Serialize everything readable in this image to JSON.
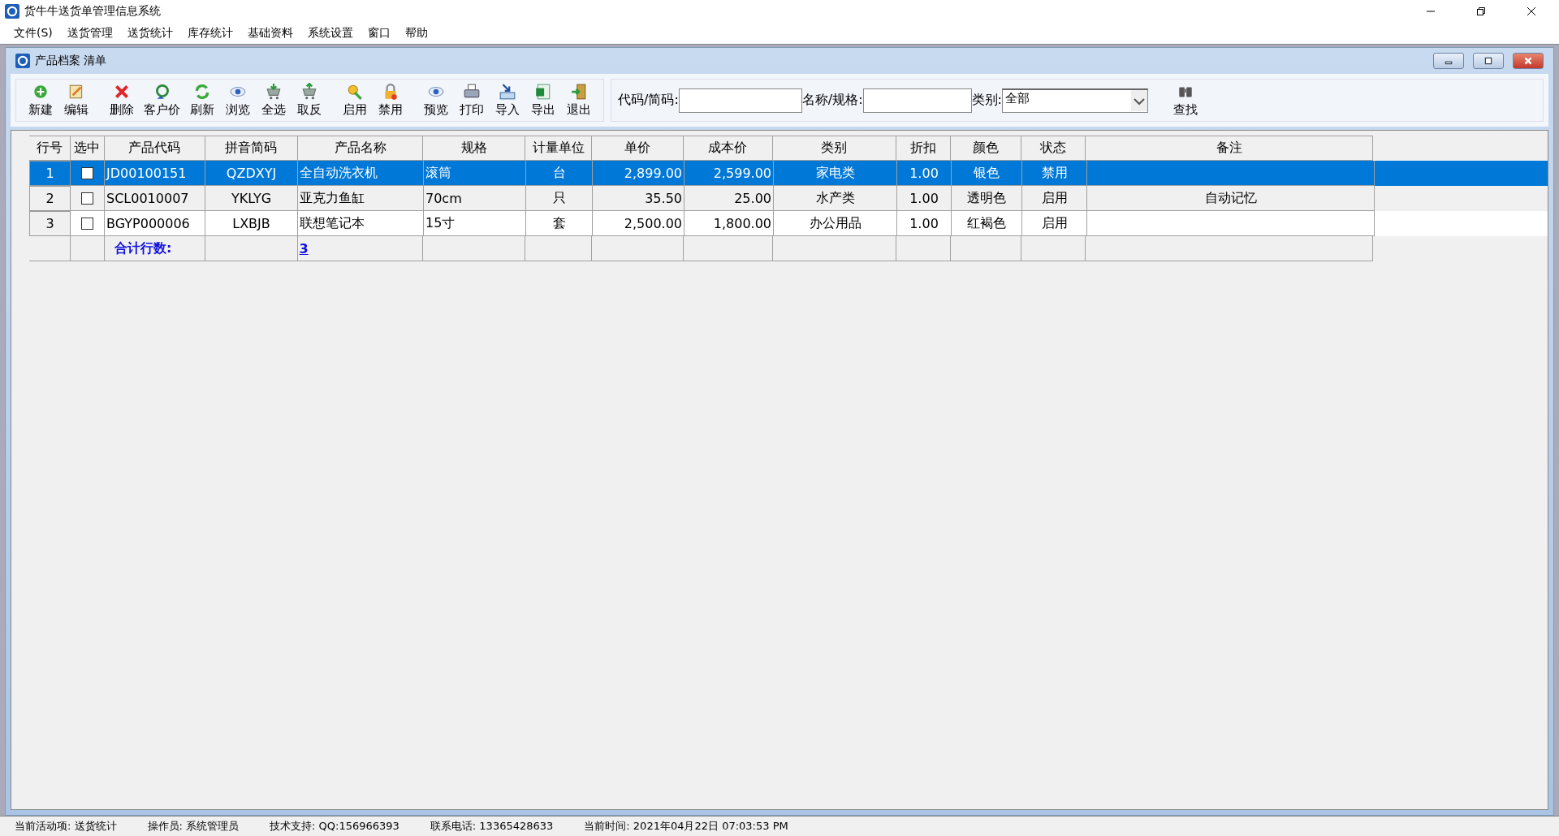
{
  "window": {
    "title": "货牛牛送货单管理信息系统"
  },
  "menu": [
    "文件(S)",
    "送货管理",
    "送货统计",
    "库存统计",
    "基础资料",
    "系统设置",
    "窗口",
    "帮助"
  ],
  "child_window": {
    "title": "产品档案 清单"
  },
  "toolbar": [
    {
      "kind": "add",
      "label": "新建"
    },
    {
      "kind": "edit",
      "label": "编辑"
    },
    {
      "kind": "delete",
      "label": "删除"
    },
    {
      "kind": "price",
      "label": "客户价"
    },
    {
      "kind": "refresh",
      "label": "刷新"
    },
    {
      "kind": "view",
      "label": "浏览"
    },
    {
      "kind": "select_all",
      "label": "全选"
    },
    {
      "kind": "invert",
      "label": "取反"
    },
    {
      "kind": "enable",
      "label": "启用"
    },
    {
      "kind": "disable",
      "label": "禁用"
    },
    {
      "kind": "view",
      "label": "预览"
    },
    {
      "kind": "print",
      "label": "打印"
    },
    {
      "kind": "import",
      "label": "导入"
    },
    {
      "kind": "export",
      "label": "导出"
    },
    {
      "kind": "exit",
      "label": "退出"
    }
  ],
  "filters": {
    "code_label": "代码/简码:",
    "name_label": "名称/规格:",
    "category_label": "类别:",
    "category_value": "全部",
    "search_label": "查找"
  },
  "table": {
    "columns": [
      "行号",
      "选中",
      "产品代码",
      "拼音简码",
      "产品名称",
      "规格",
      "计量单位",
      "单价",
      "成本价",
      "类别",
      "折扣",
      "颜色",
      "状态",
      "备注"
    ],
    "rows": [
      {
        "selected": true,
        "checked": false,
        "cells": [
          "1",
          "",
          "JD00100151",
          "QZDXYJ",
          "全自动洗衣机",
          "滚筒",
          "台",
          "2,899.00",
          "2,599.00",
          "家电类",
          "1.00",
          "银色",
          "禁用",
          ""
        ]
      },
      {
        "selected": false,
        "checked": false,
        "cells": [
          "2",
          "",
          "SCL0010007",
          "YKLYG",
          "亚克力鱼缸",
          "70cm",
          "只",
          "35.50",
          "25.00",
          "水产类",
          "1.00",
          "透明色",
          "启用",
          "自动记忆"
        ]
      },
      {
        "selected": false,
        "checked": false,
        "cells": [
          "3",
          "",
          "BGYP000006",
          "LXBJB",
          "联想笔记本",
          "15寸",
          "套",
          "2,500.00",
          "1,800.00",
          "办公用品",
          "1.00",
          "红褐色",
          "启用",
          ""
        ]
      }
    ],
    "summary": {
      "label": "合计行数:",
      "count": "3"
    }
  },
  "status_bar": [
    "当前活动项: 送货统计",
    "操作员: 系统管理员",
    "技术支持: QQ:156966393",
    "联系电话: 13365428633",
    "当前时间: 2021年04月22日 07:03:53 PM"
  ]
}
